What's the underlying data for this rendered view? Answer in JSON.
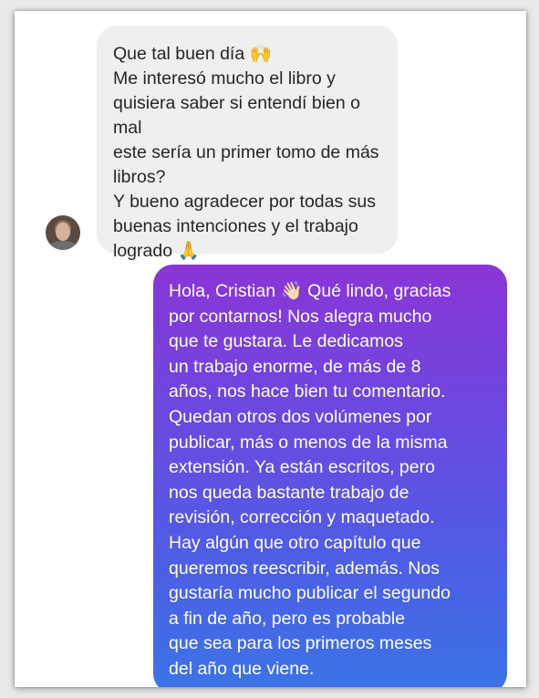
{
  "conversation": {
    "received": {
      "lines": [
        "Que tal buen día 🙌",
        "Me interesó mucho el libro y",
        "quisiera saber si entendí bien o mal",
        "este sería un primer tomo de más",
        "libros?",
        "Y bueno agradecer por todas sus",
        "buenas intenciones y el trabajo",
        "logrado 🙏"
      ],
      "avatar_icon": "user-avatar-photo"
    },
    "sent": {
      "lines": [
        "Hola, Cristian 👋🏻 Qué lindo, gracias",
        "por contarnos! Nos alegra mucho",
        "que te gustara. Le dedicamos",
        "un trabajo enorme, de más de 8",
        "años, nos hace bien tu comentario.",
        "Quedan otros dos volúmenes por",
        "publicar, más o menos de la misma",
        "extensión. Ya están escritos, pero",
        "nos queda bastante trabajo de",
        "revisión, corrección y maquetado.",
        "Hay algún que otro capítulo que",
        "queremos reescribir, además. Nos",
        "gustaría mucho publicar el segundo",
        "a fin de año, pero es probable",
        "que sea para los primeros meses",
        "del año que viene."
      ]
    }
  },
  "colors": {
    "received_bubble": "#efefef",
    "sent_gradient_top": "#8a35d6",
    "sent_gradient_bottom": "#3b74e6",
    "text_dark": "#262626",
    "text_light": "#ffffff"
  }
}
